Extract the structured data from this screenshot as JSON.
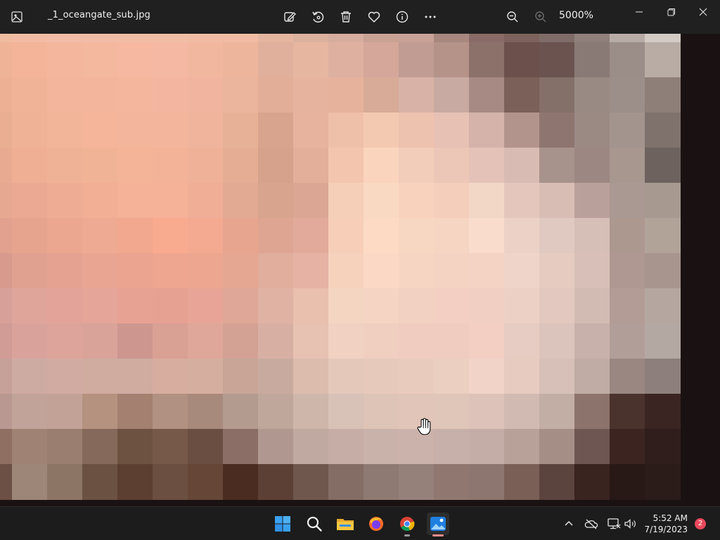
{
  "window": {
    "filename": "_1_oceangate_sub.jpg",
    "zoom_label": "5000%"
  },
  "toolbar": {
    "items": [
      "edit-icon",
      "rotate-icon",
      "delete-icon",
      "favorite-icon",
      "info-icon",
      "more-icon",
      "zoom-out-icon",
      "zoom-in-icon"
    ]
  },
  "image": {
    "description_colors": {
      "palette": [
        [
          "#efbca0",
          "#f2bca4",
          "#f3bca7",
          "#f2bda7",
          "#f2bda5",
          "#f2bda5",
          "#f2bca4",
          "#f1bca3",
          "#e6b5a0",
          "#dcb19d",
          "#d6ad9e",
          "#c9a294",
          "#c8a297",
          "#a8877f",
          "#8a6a66",
          "#7e625e",
          "#7f6c68",
          "#8f807b",
          "#b8aca6",
          "#d4cbc4"
        ],
        [
          "#efb397",
          "#f3b49a",
          "#f4b79e",
          "#f4b89e",
          "#f6b8a0",
          "#f5b8a2",
          "#f2b79f",
          "#eeb59d",
          "#e0b09c",
          "#e7b6a1",
          "#ddb0a0",
          "#d5a79a",
          "#c19c92",
          "#b59389",
          "#8c706a",
          "#6b504b",
          "#6b5450",
          "#8a7a76",
          "#9b8d87",
          "#b8aca4"
        ],
        [
          "#edb094",
          "#f1b397",
          "#f3b59b",
          "#f3b59b",
          "#f4b69c",
          "#f3b5a0",
          "#f1b59f",
          "#ebb49c",
          "#e2ae97",
          "#e6b39e",
          "#e6b29b",
          "#d8ab98",
          "#d8b2a6",
          "#c8aaa2",
          "#a78a83",
          "#7b5f59",
          "#846f69",
          "#9a8a84",
          "#9c8e88",
          "#8e7f79"
        ],
        [
          "#eaae92",
          "#f0b296",
          "#f3b59a",
          "#f4b59a",
          "#f3b69c",
          "#f3b69d",
          "#efb49b",
          "#e6b197",
          "#d8a48e",
          "#e8b39e",
          "#efc0a9",
          "#f4c9b2",
          "#edc2ae",
          "#e6c1b4",
          "#d5b3ab",
          "#b3948c",
          "#8f756f",
          "#9b8984",
          "#a3948e",
          "#7f726d"
        ],
        [
          "#e8ab91",
          "#eeaf95",
          "#f0b296",
          "#f1b395",
          "#f3b497",
          "#f2b399",
          "#efb198",
          "#e4ad94",
          "#d6a28b",
          "#e3ae9a",
          "#f3c5ae",
          "#fad4bc",
          "#f2cdba",
          "#ecc6b7",
          "#e4c2b8",
          "#d8bbb2",
          "#a8928c",
          "#9d8782",
          "#a7978f",
          "#6d625e"
        ],
        [
          "#e6a891",
          "#eba994",
          "#eeac95",
          "#f2af96",
          "#f5b298",
          "#f6b199",
          "#f1ae97",
          "#e2a993",
          "#d8a48e",
          "#dba694",
          "#f5cfb7",
          "#fad9c2",
          "#f8d2bd",
          "#f4cdbb",
          "#f2d7c7",
          "#e4c6bc",
          "#d8bdb5",
          "#baa09a",
          "#aa9992",
          "#a89990"
        ],
        [
          "#e2a08f",
          "#e6a48f",
          "#eba790",
          "#eeaa92",
          "#f1a88f",
          "#f8ab8f",
          "#f3aa91",
          "#e7a48e",
          "#dea592",
          "#e2aa9a",
          "#f7cfb8",
          "#fcdac3",
          "#f8d7c2",
          "#f6d5c3",
          "#f9dccb",
          "#ecd1c6",
          "#e0c9c0",
          "#d6bfb7",
          "#ad9890",
          "#b2a399"
        ],
        [
          "#d99a8e",
          "#e0a190",
          "#e5a291",
          "#e9a591",
          "#eaa48f",
          "#eea691",
          "#eda791",
          "#e5a692",
          "#e1ad9c",
          "#e5b2a4",
          "#f6d2bd",
          "#fad8c5",
          "#f7d5c3",
          "#f5d3c3",
          "#f4d2c4",
          "#eed4c9",
          "#e6cbc1",
          "#d8c0b8",
          "#ae9891",
          "#a8968e"
        ],
        [
          "#d7a19a",
          "#dfa59b",
          "#e3a398",
          "#e5a598",
          "#e8a293",
          "#e7a192",
          "#e8a597",
          "#dfa797",
          "#dfb2a4",
          "#e9bfae",
          "#f4d5c2",
          "#f5d4c3",
          "#f3d1c2",
          "#f2cfc2",
          "#f2cfc3",
          "#ecd0c6",
          "#e2c8bf",
          "#d2bbb3",
          "#b39c96",
          "#b5a7a0"
        ],
        [
          "#d09c95",
          "#d9a39b",
          "#dca49b",
          "#d9a399",
          "#cd978f",
          "#d9a094",
          "#dea79a",
          "#d4a295",
          "#d8b0a3",
          "#e7c2b2",
          "#f0d1c2",
          "#f0cec0",
          "#efccbf",
          "#f0ccc0",
          "#f2cec3",
          "#e6ccc2",
          "#dbc4bb",
          "#c8b1aa",
          "#b29e98",
          "#b4a8a3"
        ],
        [
          "#c6a19a",
          "#ceaba2",
          "#d1aba2",
          "#d0ab9f",
          "#cfaba0",
          "#d7ad9f",
          "#d6ae9f",
          "#c8a597",
          "#c8ab9e",
          "#dbbcad",
          "#e4c9ba",
          "#e7c9bb",
          "#e9cbbd",
          "#ebcfc1",
          "#f1d3c8",
          "#e7cac0",
          "#d6c0b7",
          "#c0aca4",
          "#9a8781",
          "#8d7f7b"
        ],
        [
          "#b89891",
          "#c2a39a",
          "#c2a296",
          "#b5927f",
          "#a3806f",
          "#b19181",
          "#a88a7c",
          "#b39b8f",
          "#c0a79b",
          "#cfb6aa",
          "#d8c1b6",
          "#dec4b6",
          "#e0c5b8",
          "#e0c5b9",
          "#dcc2b8",
          "#d1bab1",
          "#c3aea6",
          "#8c746c",
          "#4a322d",
          "#3a2522"
        ],
        [
          "#8e6f62",
          "#a08274",
          "#9a7e70",
          "#856a5b",
          "#6d5242",
          "#77594a",
          "#6a4e42",
          "#8b6f66",
          "#b09890",
          "#c0a9a1",
          "#c6aea6",
          "#c9b2aa",
          "#cbb3ab",
          "#c7b0a9",
          "#c3ada6",
          "#b7a199",
          "#a48e86",
          "#6e5752",
          "#3c2521",
          "#2f1e1c"
        ],
        [
          "#6c4f45",
          "#9d8577",
          "#8d7565",
          "#6b5141",
          "#5c3f31",
          "#6b4f41",
          "#654637",
          "#4a2c20",
          "#5c4035",
          "#6f574d",
          "#846d64",
          "#8f7a73",
          "#96817a",
          "#907871",
          "#8d766f",
          "#7a5f57",
          "#5c443e",
          "#3a2420",
          "#281816",
          "#2b1c1a"
        ]
      ]
    }
  },
  "taskbar": {
    "apps": [
      "start-icon",
      "search-icon",
      "file-explorer-icon",
      "firefox-icon",
      "chrome-icon",
      "photos-icon"
    ],
    "time": "5:52 AM",
    "date": "7/19/2023",
    "notification_count": "2"
  }
}
